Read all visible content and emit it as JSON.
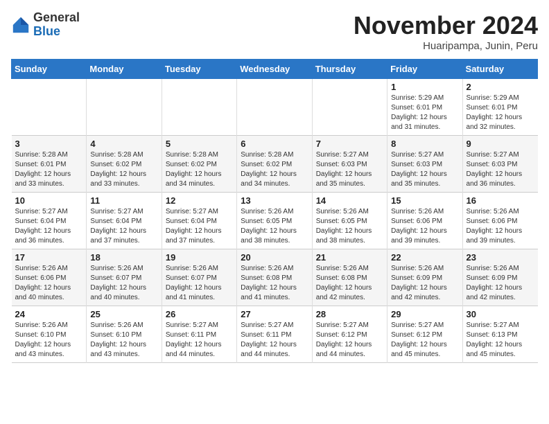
{
  "header": {
    "logo_general": "General",
    "logo_blue": "Blue",
    "month": "November 2024",
    "location": "Huaripampa, Junin, Peru"
  },
  "days_of_week": [
    "Sunday",
    "Monday",
    "Tuesday",
    "Wednesday",
    "Thursday",
    "Friday",
    "Saturday"
  ],
  "weeks": [
    [
      {
        "day": "",
        "info": ""
      },
      {
        "day": "",
        "info": ""
      },
      {
        "day": "",
        "info": ""
      },
      {
        "day": "",
        "info": ""
      },
      {
        "day": "",
        "info": ""
      },
      {
        "day": "1",
        "info": "Sunrise: 5:29 AM\nSunset: 6:01 PM\nDaylight: 12 hours and 31 minutes."
      },
      {
        "day": "2",
        "info": "Sunrise: 5:29 AM\nSunset: 6:01 PM\nDaylight: 12 hours and 32 minutes."
      }
    ],
    [
      {
        "day": "3",
        "info": "Sunrise: 5:28 AM\nSunset: 6:01 PM\nDaylight: 12 hours and 33 minutes."
      },
      {
        "day": "4",
        "info": "Sunrise: 5:28 AM\nSunset: 6:02 PM\nDaylight: 12 hours and 33 minutes."
      },
      {
        "day": "5",
        "info": "Sunrise: 5:28 AM\nSunset: 6:02 PM\nDaylight: 12 hours and 34 minutes."
      },
      {
        "day": "6",
        "info": "Sunrise: 5:28 AM\nSunset: 6:02 PM\nDaylight: 12 hours and 34 minutes."
      },
      {
        "day": "7",
        "info": "Sunrise: 5:27 AM\nSunset: 6:03 PM\nDaylight: 12 hours and 35 minutes."
      },
      {
        "day": "8",
        "info": "Sunrise: 5:27 AM\nSunset: 6:03 PM\nDaylight: 12 hours and 35 minutes."
      },
      {
        "day": "9",
        "info": "Sunrise: 5:27 AM\nSunset: 6:03 PM\nDaylight: 12 hours and 36 minutes."
      }
    ],
    [
      {
        "day": "10",
        "info": "Sunrise: 5:27 AM\nSunset: 6:04 PM\nDaylight: 12 hours and 36 minutes."
      },
      {
        "day": "11",
        "info": "Sunrise: 5:27 AM\nSunset: 6:04 PM\nDaylight: 12 hours and 37 minutes."
      },
      {
        "day": "12",
        "info": "Sunrise: 5:27 AM\nSunset: 6:04 PM\nDaylight: 12 hours and 37 minutes."
      },
      {
        "day": "13",
        "info": "Sunrise: 5:26 AM\nSunset: 6:05 PM\nDaylight: 12 hours and 38 minutes."
      },
      {
        "day": "14",
        "info": "Sunrise: 5:26 AM\nSunset: 6:05 PM\nDaylight: 12 hours and 38 minutes."
      },
      {
        "day": "15",
        "info": "Sunrise: 5:26 AM\nSunset: 6:06 PM\nDaylight: 12 hours and 39 minutes."
      },
      {
        "day": "16",
        "info": "Sunrise: 5:26 AM\nSunset: 6:06 PM\nDaylight: 12 hours and 39 minutes."
      }
    ],
    [
      {
        "day": "17",
        "info": "Sunrise: 5:26 AM\nSunset: 6:06 PM\nDaylight: 12 hours and 40 minutes."
      },
      {
        "day": "18",
        "info": "Sunrise: 5:26 AM\nSunset: 6:07 PM\nDaylight: 12 hours and 40 minutes."
      },
      {
        "day": "19",
        "info": "Sunrise: 5:26 AM\nSunset: 6:07 PM\nDaylight: 12 hours and 41 minutes."
      },
      {
        "day": "20",
        "info": "Sunrise: 5:26 AM\nSunset: 6:08 PM\nDaylight: 12 hours and 41 minutes."
      },
      {
        "day": "21",
        "info": "Sunrise: 5:26 AM\nSunset: 6:08 PM\nDaylight: 12 hours and 42 minutes."
      },
      {
        "day": "22",
        "info": "Sunrise: 5:26 AM\nSunset: 6:09 PM\nDaylight: 12 hours and 42 minutes."
      },
      {
        "day": "23",
        "info": "Sunrise: 5:26 AM\nSunset: 6:09 PM\nDaylight: 12 hours and 42 minutes."
      }
    ],
    [
      {
        "day": "24",
        "info": "Sunrise: 5:26 AM\nSunset: 6:10 PM\nDaylight: 12 hours and 43 minutes."
      },
      {
        "day": "25",
        "info": "Sunrise: 5:26 AM\nSunset: 6:10 PM\nDaylight: 12 hours and 43 minutes."
      },
      {
        "day": "26",
        "info": "Sunrise: 5:27 AM\nSunset: 6:11 PM\nDaylight: 12 hours and 44 minutes."
      },
      {
        "day": "27",
        "info": "Sunrise: 5:27 AM\nSunset: 6:11 PM\nDaylight: 12 hours and 44 minutes."
      },
      {
        "day": "28",
        "info": "Sunrise: 5:27 AM\nSunset: 6:12 PM\nDaylight: 12 hours and 44 minutes."
      },
      {
        "day": "29",
        "info": "Sunrise: 5:27 AM\nSunset: 6:12 PM\nDaylight: 12 hours and 45 minutes."
      },
      {
        "day": "30",
        "info": "Sunrise: 5:27 AM\nSunset: 6:13 PM\nDaylight: 12 hours and 45 minutes."
      }
    ]
  ]
}
